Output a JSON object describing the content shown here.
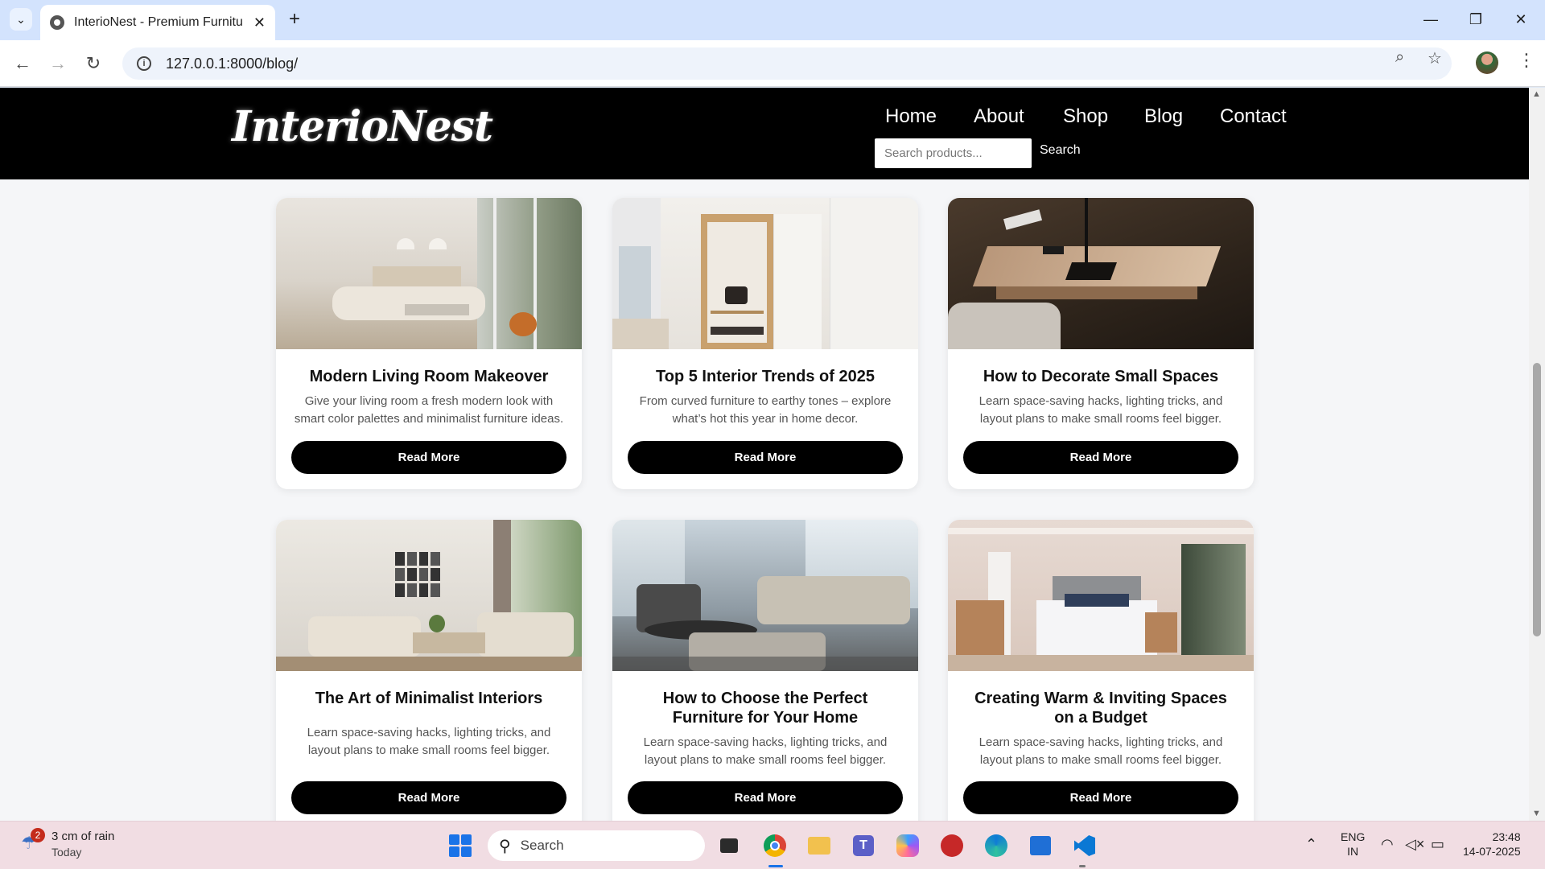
{
  "browser": {
    "tab_title": "InterioNest - Premium Furniture",
    "url": "127.0.0.1:8000/blog/"
  },
  "site": {
    "logo": "InterioNest",
    "nav": [
      "Home",
      "About",
      "Shop",
      "Blog",
      "Contact"
    ],
    "search_placeholder": "Search products...",
    "search_button": "Search"
  },
  "posts": [
    {
      "title": "Modern Living Room Makeover",
      "desc": "Give your living room a fresh modern look with smart color palettes and minimalist furniture ideas.",
      "button": "Read More"
    },
    {
      "title": "Top 5 Interior Trends of 2025",
      "desc": "From curved furniture to earthy tones – explore what’s hot this year in home decor.",
      "button": "Read More"
    },
    {
      "title": "How to Decorate Small Spaces",
      "desc": "Learn space-saving hacks, lighting tricks, and layout plans to make small rooms feel bigger.",
      "button": "Read More"
    },
    {
      "title": "The Art of Minimalist Interiors",
      "desc": "Learn space-saving hacks, lighting tricks, and layout plans to make small rooms feel bigger.",
      "button": "Read More"
    },
    {
      "title": "How to Choose the Perfect Furniture for Your Home",
      "desc": "Learn space-saving hacks, lighting tricks, and layout plans to make small rooms feel bigger.",
      "button": "Read More"
    },
    {
      "title": "Creating Warm & Inviting Spaces on a Budget",
      "desc": "Learn space-saving hacks, lighting tricks, and layout plans to make small rooms feel bigger.",
      "button": "Read More"
    }
  ],
  "taskbar": {
    "weather_badge": "2",
    "weather_text": "3 cm of rain",
    "weather_sub": "Today",
    "search_label": "Search",
    "lang_top": "ENG",
    "lang_bottom": "IN",
    "time": "23:48",
    "date": "14-07-2025"
  },
  "colors": {
    "header_bg": "#000000",
    "button_bg": "#000000",
    "page_bg": "#f5f6f8"
  }
}
